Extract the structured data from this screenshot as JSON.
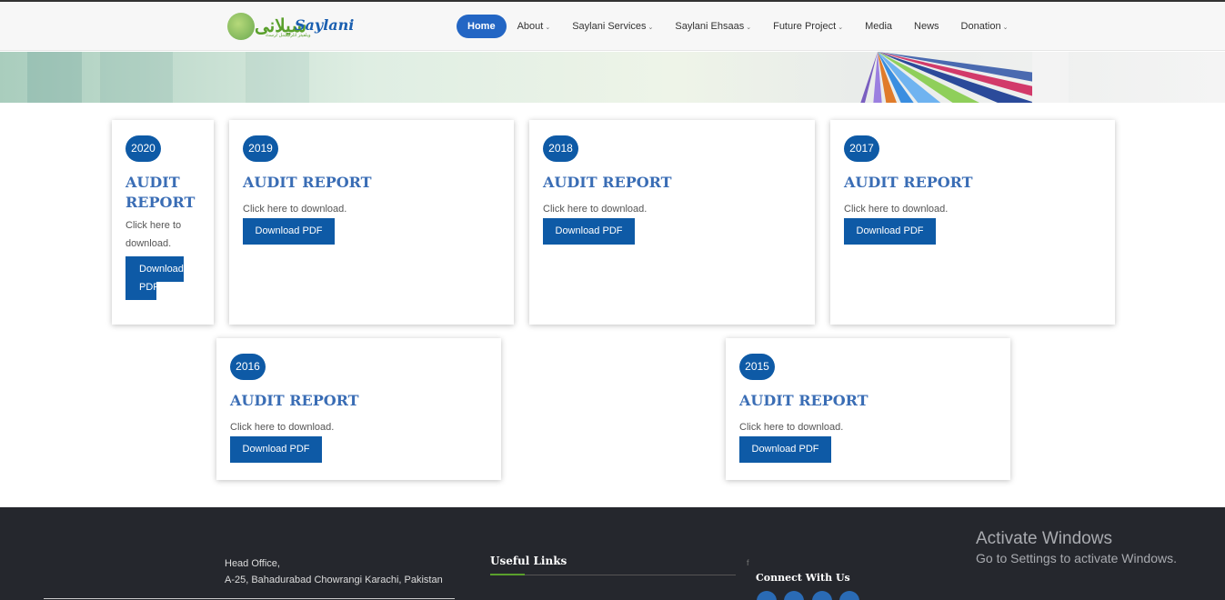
{
  "header": {
    "logo": {
      "urdu": "سیلانی",
      "text": "Saylani",
      "sub": "ویلفیئر انٹرنیشنل ٹرسٹ"
    },
    "nav": [
      {
        "label": "Home",
        "active": true,
        "dropdown": false
      },
      {
        "label": "About",
        "dropdown": true
      },
      {
        "label": "Saylani Services",
        "dropdown": true
      },
      {
        "label": "Saylani Ehsaas",
        "dropdown": true
      },
      {
        "label": "Future Project",
        "dropdown": true
      },
      {
        "label": "Media",
        "dropdown": false
      },
      {
        "label": "News",
        "dropdown": false
      },
      {
        "label": "Donation",
        "dropdown": true
      }
    ]
  },
  "reports": [
    {
      "year": "2020",
      "title": "AUDIT REPORT",
      "desc": "Click here to download.",
      "button": "Download PDF"
    },
    {
      "year": "2019",
      "title": "AUDIT REPORT",
      "desc": "Click here to download.",
      "button": "Download PDF"
    },
    {
      "year": "2018",
      "title": "AUDIT REPORT",
      "desc": "Click here to download.",
      "button": "Download PDF"
    },
    {
      "year": "2017",
      "title": "AUDIT REPORT",
      "desc": "Click here to download.",
      "button": "Download PDF"
    },
    {
      "year": "2016",
      "title": "AUDIT REPORT",
      "desc": "Click here to download.",
      "button": "Download PDF"
    },
    {
      "year": "2015",
      "title": "AUDIT REPORT",
      "desc": "Click here to download.",
      "button": "Download PDF"
    }
  ],
  "footer": {
    "address_line1": "Head Office,",
    "address_line2": "A-25, Bahadurabad Chowrangi Karachi, Pakistan",
    "useful_links": "Useful Links",
    "small_f": "f",
    "connect": "Connect With Us",
    "social_icons": [
      "facebook-icon",
      "twitter-icon",
      "instagram-icon",
      "youtube-icon"
    ]
  },
  "watermark": {
    "line1": "Activate Windows",
    "line2": "Go to Settings to activate Windows."
  },
  "colors": {
    "accent": "#0e5aa6",
    "nav_active": "#2366c4",
    "title": "#3a6db5",
    "footer_bg": "#25272d",
    "green": "#5aa02c"
  }
}
